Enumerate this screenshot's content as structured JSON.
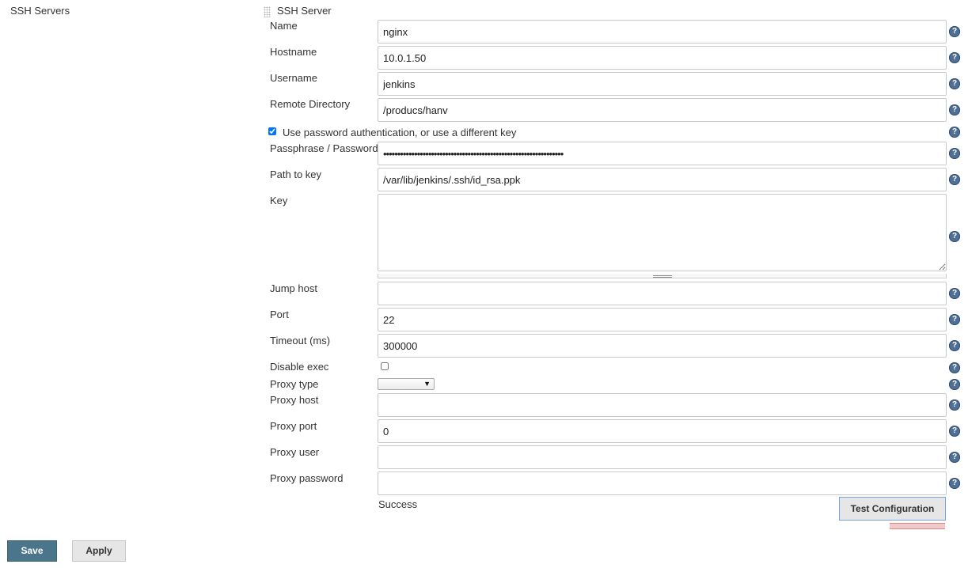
{
  "section": {
    "title": "SSH Servers"
  },
  "server": {
    "title": "SSH Server",
    "name": {
      "label": "Name",
      "value": "nginx"
    },
    "hostname": {
      "label": "Hostname",
      "value": "10.0.1.50"
    },
    "username": {
      "label": "Username",
      "value": "jenkins"
    },
    "remote_directory": {
      "label": "Remote Directory",
      "value": "/producs/hanv"
    },
    "use_password_auth": {
      "label": "Use password authentication, or use a different key",
      "checked": true
    },
    "passphrase": {
      "label": "Passphrase / Password",
      "value": "••••••••••••••••••••••••••••••••••••••••••••••••••••••••••••••••"
    },
    "path_to_key": {
      "label": "Path to key",
      "value": "/var/lib/jenkins/.ssh/id_rsa.ppk"
    },
    "key": {
      "label": "Key",
      "value": ""
    },
    "jump_host": {
      "label": "Jump host",
      "value": ""
    },
    "port": {
      "label": "Port",
      "value": "22"
    },
    "timeout": {
      "label": "Timeout (ms)",
      "value": "300000"
    },
    "disable_exec": {
      "label": "Disable exec",
      "checked": false
    },
    "proxy_type": {
      "label": "Proxy type",
      "value": ""
    },
    "proxy_host": {
      "label": "Proxy host",
      "value": ""
    },
    "proxy_port": {
      "label": "Proxy port",
      "value": "0"
    },
    "proxy_user": {
      "label": "Proxy user",
      "value": ""
    },
    "proxy_password": {
      "label": "Proxy password",
      "value": ""
    }
  },
  "test": {
    "status": "Success",
    "button_label": "Test Configuration"
  },
  "actions": {
    "save_label": "Save",
    "apply_label": "Apply"
  },
  "icons": {
    "help": "help-icon",
    "grip": "drag-handle-icon",
    "dropdown": "dropdown-arrow-icon"
  },
  "colors": {
    "help_icon": "#4f6f95",
    "save_button": "#4b758b",
    "test_button_border": "#7aa0d8"
  }
}
